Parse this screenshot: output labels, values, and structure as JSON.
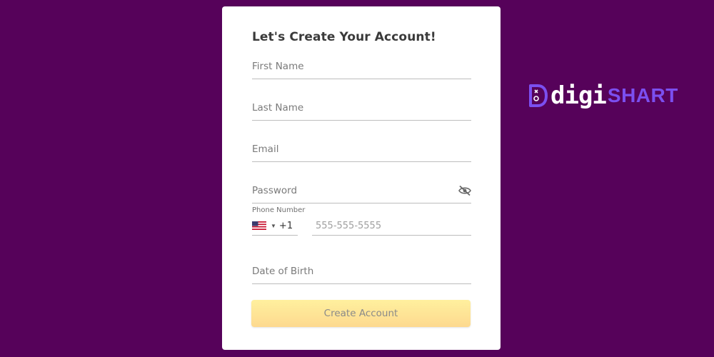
{
  "form": {
    "title": "Let's Create Your Account!",
    "first_name_placeholder": "First Name",
    "last_name_placeholder": "Last Name",
    "email_placeholder": "Email",
    "password_placeholder": "Password",
    "phone_label": "Phone Number",
    "country_code": "+1",
    "phone_placeholder": "555-555-5555",
    "dob_placeholder": "Date of Birth",
    "submit_label": "Create Account"
  },
  "brand": {
    "name_part1": "digi",
    "name_part2": "SHART"
  },
  "icons": {
    "password_toggle": "eye-off-icon",
    "country_flag": "us-flag-icon",
    "country_caret": "caret-down-icon",
    "brand_logo": "digishart-logo-icon"
  },
  "colors": {
    "background": "#56025a",
    "card": "#ffffff",
    "button_top": "#fff09e",
    "button_bottom": "#fdd98f",
    "brand_accent": "#7b4ff0"
  }
}
